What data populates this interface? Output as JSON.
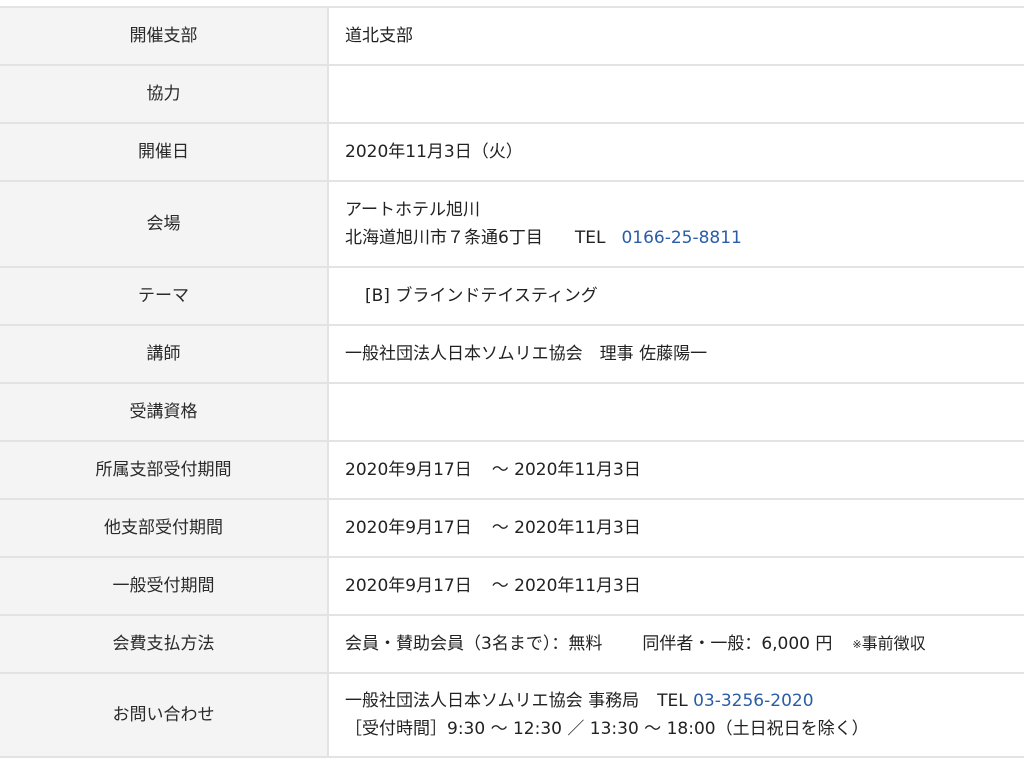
{
  "rows": {
    "branch": {
      "label": "開催支部",
      "value": "道北支部"
    },
    "cooperation": {
      "label": "協力",
      "value": ""
    },
    "date": {
      "label": "開催日",
      "value": "2020年11月3日（火）"
    },
    "venue": {
      "label": "会場",
      "name": "アートホテル旭川",
      "address": "北海道旭川市７条通6丁目",
      "tel_label": "TEL",
      "tel": "0166-25-8811"
    },
    "theme": {
      "label": "テーマ",
      "value": "[B] ブラインドテイスティング"
    },
    "lecturer": {
      "label": "講師",
      "value": "一般社団法人日本ソムリエ協会　理事 佐藤陽一"
    },
    "qualification": {
      "label": "受講資格",
      "value": ""
    },
    "own_branch_period": {
      "label": "所属支部受付期間",
      "start": "2020年9月17日",
      "end": "～ 2020年11月3日"
    },
    "other_branch_period": {
      "label": "他支部受付期間",
      "start": "2020年9月17日",
      "end": "～ 2020年11月3日"
    },
    "general_period": {
      "label": "一般受付期間",
      "start": "2020年9月17日",
      "end": "～ 2020年11月3日"
    },
    "fee": {
      "label": "会費支払方法",
      "member": "会員・賛助会員（3名まで）：無料",
      "companion": "同伴者・一般：6,000 円",
      "note_mark": "※",
      "note": "事前徴収"
    },
    "contact": {
      "label": "お問い合わせ",
      "org": "一般社団法人日本ソムリエ協会 事務局",
      "tel_label": "TEL",
      "tel": "03-3256-2020",
      "hours": "［受付時間］9:30 ～ 12:30 ／ 13:30 ～ 18:00（土日祝日を除く）"
    }
  }
}
